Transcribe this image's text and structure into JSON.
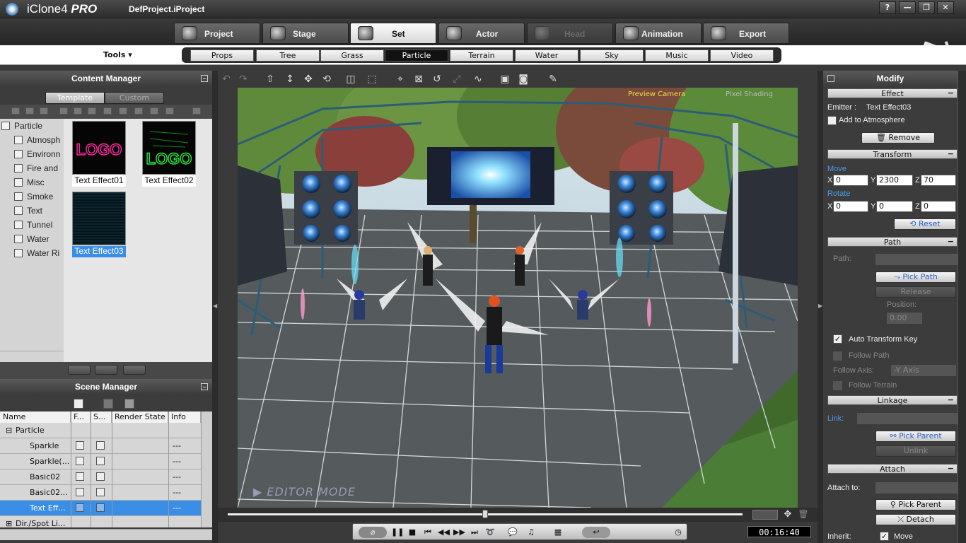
{
  "app": {
    "brand": "iClone",
    "version": "4",
    "edition": "PRO",
    "project": "DefProject.iProject"
  },
  "window_buttons": [
    "?",
    "—",
    "❐",
    "✕"
  ],
  "main_tabs": [
    {
      "label": "Project",
      "icon": "project-icon",
      "state": "normal"
    },
    {
      "label": "Stage",
      "icon": "stage-icon",
      "state": "normal"
    },
    {
      "label": "Set",
      "icon": "set-icon",
      "state": "active"
    },
    {
      "label": "Actor",
      "icon": "actor-icon",
      "state": "normal"
    },
    {
      "label": "Head",
      "icon": "head-icon",
      "state": "disabled"
    },
    {
      "label": "Animation",
      "icon": "animation-icon",
      "state": "normal"
    },
    {
      "label": "Export",
      "icon": "export-icon",
      "state": "normal"
    }
  ],
  "tools_menu": "Tools ▾",
  "sub_tabs": [
    {
      "label": "Props"
    },
    {
      "label": "Tree"
    },
    {
      "label": "Grass"
    },
    {
      "label": "Particle",
      "active": true
    },
    {
      "label": "Terrain"
    },
    {
      "label": "Water"
    },
    {
      "label": "Sky"
    },
    {
      "label": "Music"
    },
    {
      "label": "Video"
    }
  ],
  "content_manager": {
    "title": "Content Manager",
    "tabs": [
      {
        "label": "Template",
        "active": true
      },
      {
        "label": "Custom",
        "active": false
      }
    ],
    "tree": [
      "Particle",
      "Atmosph",
      "Environn",
      "Fire and",
      "Misc",
      "Smoke",
      "Text",
      "Tunnel",
      "Water",
      "Water Ri"
    ],
    "items": [
      {
        "label": "Text Effect01",
        "selected": false
      },
      {
        "label": "Text Effect02",
        "selected": false
      },
      {
        "label": "Text Effect03",
        "selected": true
      }
    ],
    "thumb_text": [
      "LOGO",
      "LOGO"
    ]
  },
  "scene_manager": {
    "title": "Scene Manager",
    "columns": [
      "Name",
      "F...",
      "S...",
      "Render State",
      "Info"
    ],
    "rows": [
      {
        "name": "Particle",
        "type": "group",
        "info": ""
      },
      {
        "name": "Sparkle",
        "info": "---"
      },
      {
        "name": "Sparkle(...",
        "info": "---"
      },
      {
        "name": "Basic02",
        "info": "---"
      },
      {
        "name": "Basic02...",
        "info": "---"
      },
      {
        "name": "Text Eff...",
        "info": "---",
        "selected": true
      },
      {
        "name": "Dir./Spot Li...",
        "type": "group",
        "info": ""
      }
    ]
  },
  "viewport": {
    "camera": "Preview Camera",
    "shading": "Pixel Shading",
    "mode_label": "EDITOR MODE"
  },
  "playback": {
    "timecode": "00:16:40",
    "progress": 0.5
  },
  "modify": {
    "title": "Modify",
    "effect": {
      "header": "Effect",
      "emitter_label": "Emitter :",
      "emitter_value": "Text Effect03",
      "add_to_atmosphere": "Add to Atmosphere",
      "remove": "Remove"
    },
    "transform": {
      "header": "Transform",
      "move_label": "Move",
      "move": {
        "x": "0",
        "y": "2300",
        "z": "70"
      },
      "rotate_label": "Rotate",
      "rotate": {
        "x": "0",
        "y": "0",
        "z": "0"
      },
      "reset": "Reset",
      "axes": [
        "X",
        "Y",
        "Z"
      ]
    },
    "path": {
      "header": "Path",
      "path_label": "Path:",
      "pick_path": "Pick Path",
      "release": "Release",
      "position_label": "Position:",
      "position_value": "0.00",
      "auto_transform_key": "Auto Transform Key",
      "auto_transform_checked": true,
      "follow_path": "Follow Path",
      "follow_axis_label": "Follow Axis:",
      "follow_axis_value": "-Y Axis",
      "follow_terrain": "Follow Terrain"
    },
    "linkage": {
      "header": "Linkage",
      "link_label": "Link:",
      "pick_parent": "Pick Parent",
      "unlink": "Unlink"
    },
    "attach": {
      "header": "Attach",
      "attach_label": "Attach to:",
      "pick_parent": "Pick Parent",
      "detach": "Detach",
      "inherit_label": "Inherit:",
      "inherit_move": "Move",
      "inherit_checked": true
    }
  },
  "colors": {
    "accent_blue": "#3a8ee6",
    "camera_label": "#f0e14a",
    "panel_bg": "#3c3c3c"
  }
}
